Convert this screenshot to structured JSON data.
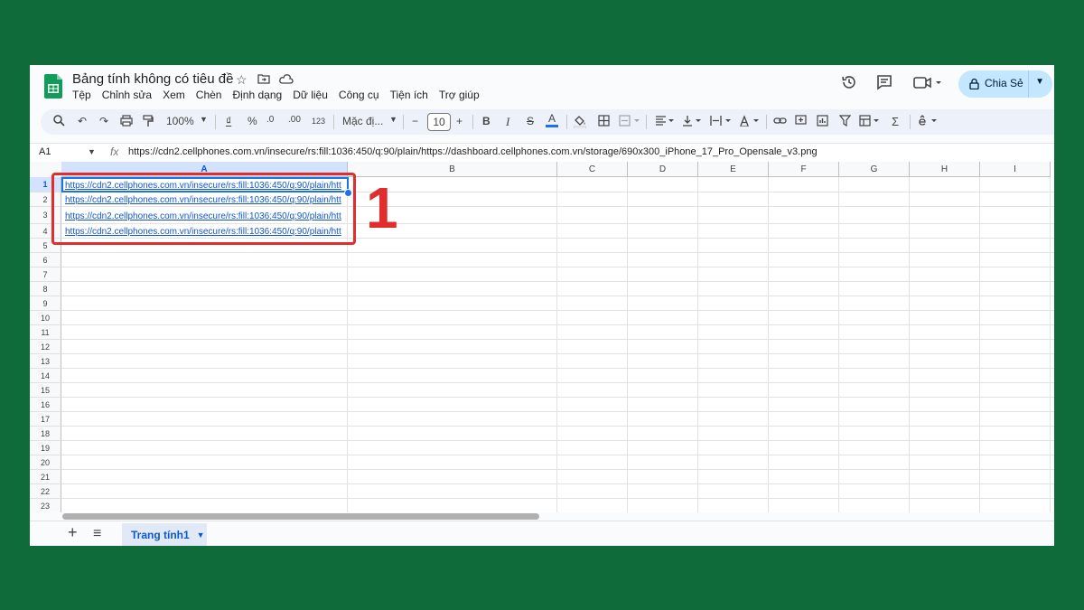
{
  "doc": {
    "title": "Bảng tính không có tiêu đề"
  },
  "menu": [
    "Tệp",
    "Chỉnh sửa",
    "Xem",
    "Chèn",
    "Định dạng",
    "Dữ liệu",
    "Công cụ",
    "Tiện ích",
    "Trợ giúp"
  ],
  "share": {
    "label": "Chia Sẻ"
  },
  "toolbar": {
    "zoom": "100%",
    "currency": "₫",
    "percent": "%",
    "dec_decrease": ".0",
    "dec_increase": ".00",
    "format_123": "123",
    "font": "Mặc đị...",
    "font_size": "10",
    "minus": "−",
    "plus": "+",
    "bold": "B",
    "italic": "I",
    "strike": "S",
    "text_color": "A"
  },
  "formula": {
    "namebox": "A1",
    "fx": "fx",
    "value": "https://cdn2.cellphones.com.vn/insecure/rs:fill:1036:450/q:90/plain/https://dashboard.cellphones.com.vn/storage/690x300_iPhone_17_Pro_Opensale_v3.png"
  },
  "columns": [
    "A",
    "B",
    "C",
    "D",
    "E",
    "F",
    "G",
    "H",
    "I"
  ],
  "rows": [
    "1",
    "2",
    "3",
    "4",
    "5",
    "6",
    "7",
    "8",
    "9",
    "10",
    "11",
    "12",
    "13",
    "14",
    "15",
    "16",
    "17",
    "18",
    "19",
    "20",
    "21",
    "22",
    "23"
  ],
  "cells": [
    "https://cdn2.cellphones.com.vn/insecure/rs:fill:1036:450/q:90/plain/htt",
    "https://cdn2.cellphones.com.vn/insecure/rs:fill:1036:450/q:90/plain/htt",
    "https://cdn2.cellphones.com.vn/insecure/rs:fill:1036:450/q:90/plain/htt",
    "https://cdn2.cellphones.com.vn/insecure/rs:fill:1036:450/q:90/plain/htt"
  ],
  "annotation": {
    "label": "1",
    "color": "#e02d2d"
  },
  "sheet": {
    "tab": "Trang tính1"
  },
  "colors": {
    "background": "#0f6b3a",
    "accent": "#0b57d0",
    "share_bg": "#c2e7ff",
    "link": "#1155cc"
  }
}
